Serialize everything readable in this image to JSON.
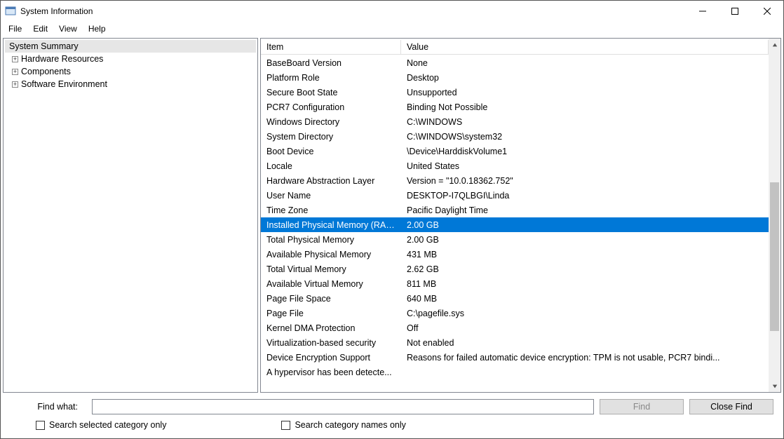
{
  "window": {
    "title": "System Information"
  },
  "menu": {
    "file": "File",
    "edit": "Edit",
    "view": "View",
    "help": "Help"
  },
  "tree": {
    "root": "System Summary",
    "items": [
      "Hardware Resources",
      "Components",
      "Software Environment"
    ]
  },
  "columns": {
    "item": "Item",
    "value": "Value"
  },
  "selected_index": 11,
  "rows": [
    {
      "item": "BaseBoard Version",
      "value": "None"
    },
    {
      "item": "Platform Role",
      "value": "Desktop"
    },
    {
      "item": "Secure Boot State",
      "value": "Unsupported"
    },
    {
      "item": "PCR7 Configuration",
      "value": "Binding Not Possible"
    },
    {
      "item": "Windows Directory",
      "value": "C:\\WINDOWS"
    },
    {
      "item": "System Directory",
      "value": "C:\\WINDOWS\\system32"
    },
    {
      "item": "Boot Device",
      "value": "\\Device\\HarddiskVolume1"
    },
    {
      "item": "Locale",
      "value": "United States"
    },
    {
      "item": "Hardware Abstraction Layer",
      "value": "Version = \"10.0.18362.752\""
    },
    {
      "item": "User Name",
      "value": "DESKTOP-I7QLBGI\\Linda"
    },
    {
      "item": "Time Zone",
      "value": "Pacific Daylight Time"
    },
    {
      "item": "Installed Physical Memory (RAM)",
      "value": "2.00 GB"
    },
    {
      "item": "Total Physical Memory",
      "value": "2.00 GB"
    },
    {
      "item": "Available Physical Memory",
      "value": "431 MB"
    },
    {
      "item": "Total Virtual Memory",
      "value": "2.62 GB"
    },
    {
      "item": "Available Virtual Memory",
      "value": "811 MB"
    },
    {
      "item": "Page File Space",
      "value": "640 MB"
    },
    {
      "item": "Page File",
      "value": "C:\\pagefile.sys"
    },
    {
      "item": "Kernel DMA Protection",
      "value": "Off"
    },
    {
      "item": "Virtualization-based security",
      "value": "Not enabled"
    },
    {
      "item": "Device Encryption Support",
      "value": "Reasons for failed automatic device encryption: TPM is not usable, PCR7 bindi..."
    },
    {
      "item": "A hypervisor has been detecte...",
      "value": ""
    }
  ],
  "footer": {
    "find_label": "Find what:",
    "find_btn": "Find",
    "close_btn": "Close Find",
    "check1": "Search selected category only",
    "check2": "Search category names only",
    "find_value": ""
  }
}
